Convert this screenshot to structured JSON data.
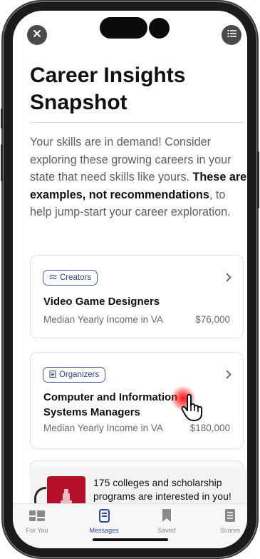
{
  "header": {
    "title": "Career Insights Snapshot",
    "close_icon": "close-icon",
    "menu_icon": "list-icon"
  },
  "intro": {
    "text_part1": "Your skills are in demand! Consider exploring these growing careers in your state that need skills like yours. ",
    "text_bold": "These are examples, not recommendations",
    "text_part2": ", to help jump-start your career exploration."
  },
  "cards": [
    {
      "tag": "Creators",
      "tag_icon": "palette-icon",
      "title": "Video Game Designers",
      "income_label": "Median Yearly Income in VA",
      "income_value": "$76,000"
    },
    {
      "tag": "Organizers",
      "tag_icon": "clipboard-icon",
      "title": "Computer and Information Systems Managers",
      "income_label": "Median Yearly Income in VA",
      "income_value": "$180,000"
    }
  ],
  "banner": {
    "text": "175 colleges and scholarship programs are interested in you!"
  },
  "tabs": [
    {
      "label": "For You",
      "icon": "dashboard-icon",
      "active": false
    },
    {
      "label": "Messages",
      "icon": "message-icon",
      "active": true
    },
    {
      "label": "Saved",
      "icon": "bookmark-icon",
      "active": false
    },
    {
      "label": "Scores",
      "icon": "scores-icon",
      "active": false
    }
  ],
  "colors": {
    "accent": "#2b4aa8",
    "tag_border": "#4b5f9e",
    "logo_red": "#b5102a"
  }
}
